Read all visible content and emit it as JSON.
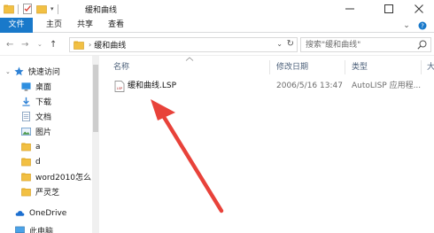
{
  "window": {
    "title": "缓和曲线"
  },
  "ribbon": {
    "tabs": [
      "文件",
      "主页",
      "共享",
      "查看"
    ]
  },
  "address": {
    "crumb": "缓和曲线"
  },
  "search": {
    "placeholder": "搜索\"缓和曲线\""
  },
  "sidebar": {
    "items": [
      {
        "label": "快速访问",
        "icon": "star-icon"
      },
      {
        "label": "桌面",
        "icon": "desktop-icon",
        "pinned": true
      },
      {
        "label": "下载",
        "icon": "download-icon",
        "pinned": true
      },
      {
        "label": "文档",
        "icon": "document-icon",
        "pinned": true
      },
      {
        "label": "图片",
        "icon": "picture-icon",
        "pinned": true
      },
      {
        "label": "a",
        "icon": "folder-icon"
      },
      {
        "label": "d",
        "icon": "folder-icon"
      },
      {
        "label": "word2010怎么",
        "icon": "folder-icon"
      },
      {
        "label": "严灵芝",
        "icon": "folder-icon"
      },
      {
        "label": "OneDrive",
        "icon": "cloud-icon"
      },
      {
        "label": "此电脑",
        "icon": "computer-icon"
      }
    ]
  },
  "columns": [
    "名称",
    "修改日期",
    "类型",
    "大"
  ],
  "files": [
    {
      "name": "缓和曲线.LSP",
      "modified": "2006/5/16 13:47",
      "type": "AutoLISP 应用程..."
    }
  ],
  "colors": {
    "accent": "#1979ca",
    "arrow": "#e8423a",
    "folder": "#f2c043"
  }
}
